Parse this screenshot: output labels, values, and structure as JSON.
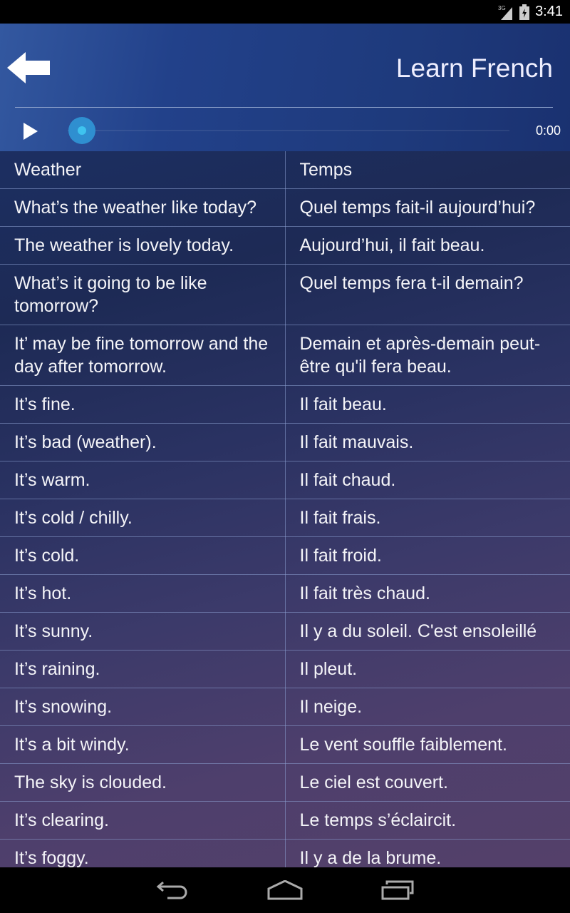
{
  "status_bar": {
    "network": "3G",
    "time": "3:41",
    "icons": [
      "signal-icon",
      "battery-icon"
    ]
  },
  "header": {
    "title": "Learn French",
    "back_icon": "arrow-left-icon"
  },
  "player": {
    "time": "0:00",
    "progress": 0,
    "play_icon": "play-icon"
  },
  "table": {
    "rows": [
      [
        "Weather",
        "Temps"
      ],
      [
        "What’s the weather like today?",
        "Quel temps fait-il aujourd’hui?"
      ],
      [
        "The weather is lovely today.",
        "Aujourd’hui, il fait beau."
      ],
      [
        "What’s it going to be like tomorrow?",
        "Quel temps fera t-il demain?"
      ],
      [
        "It’ may be fine tomorrow and the day after tomorrow.",
        "Demain et après-demain peut-être qu'il fera beau."
      ],
      [
        "It’s fine.",
        "Il fait beau."
      ],
      [
        "It’s bad (weather).",
        "Il fait mauvais."
      ],
      [
        "It’s warm.",
        "Il fait chaud."
      ],
      [
        "It’s cold / chilly.",
        "Il fait frais."
      ],
      [
        "It’s cold.",
        "Il fait froid."
      ],
      [
        "It’s hot.",
        "Il fait très chaud."
      ],
      [
        "It’s sunny.",
        "Il y a du soleil. C'est ensoleillé"
      ],
      [
        "It’s raining.",
        "Il pleut."
      ],
      [
        "It’s snowing.",
        "Il neige."
      ],
      [
        "It’s a bit windy.",
        "Le vent souffle faiblement."
      ],
      [
        "The sky is clouded.",
        "Le ciel est couvert."
      ],
      [
        "It’s clearing.",
        "Le temps s’éclaircit."
      ],
      [
        "It’s foggy.",
        "Il y a de la brume."
      ]
    ]
  },
  "nav_bar": {
    "icons": [
      "back-icon",
      "home-icon",
      "recents-icon"
    ]
  }
}
